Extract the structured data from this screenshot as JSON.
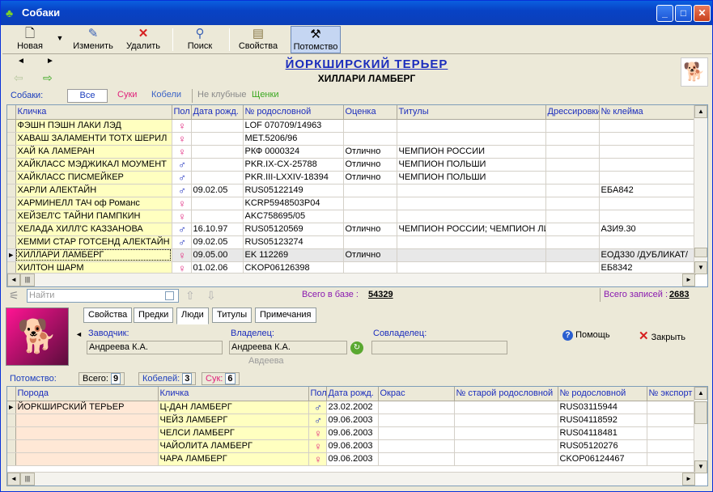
{
  "window": {
    "title": "Собаки"
  },
  "toolbar": {
    "new_label": "Новая",
    "edit_label": "Изменить",
    "delete_label": "Удалить",
    "search_label": "Поиск",
    "props_label": "Свойства",
    "offspring_label": "Потомство"
  },
  "header": {
    "breed": "ЙОРКШИРСКИЙ ТЕРЬЕР",
    "dog": "ХИЛЛАРИ ЛАМБЕРГ"
  },
  "filter": {
    "label": "Собаки:",
    "tabs": [
      "Все",
      "Суки",
      "Кобели",
      "Не клубные",
      "Щенки"
    ]
  },
  "dogs": {
    "columns": [
      "Кличка",
      "Пол",
      "Дата рожд.",
      "№ родословной",
      "Оценка",
      "Титулы",
      "Дрессировки",
      "№ клейма"
    ],
    "rows": [
      {
        "name": "ФЭШН ПЭШН ЛАКИ ЛЭД",
        "sex": "f",
        "born": "",
        "pedigree": "LOF 070709/14963",
        "grade": "",
        "titles": "",
        "training": "",
        "brand": ""
      },
      {
        "name": "ХАВАШ ЗАЛАМЕНТИ ТОТХ ШЕРИЛ",
        "sex": "f",
        "born": "",
        "pedigree": "MET.5206/96",
        "grade": "",
        "titles": "",
        "training": "",
        "brand": ""
      },
      {
        "name": "ХАЙ КА ЛАМЕРАН",
        "sex": "f",
        "born": "",
        "pedigree": "РКФ 0000324",
        "grade": "Отлично",
        "titles": "ЧЕМПИОН РОССИИ",
        "training": "",
        "brand": ""
      },
      {
        "name": "ХАЙКЛАСС МЭДЖИКАЛ МОУМЕНТ",
        "sex": "m",
        "born": "",
        "pedigree": "PKR.IX-CX-25788",
        "grade": "Отлично",
        "titles": "ЧЕМПИОН ПОЛЬШИ",
        "training": "",
        "brand": ""
      },
      {
        "name": "ХАЙКЛАСС ПИСМЕЙКЕР",
        "sex": "m",
        "born": "",
        "pedigree": "PKR.III-LXXIV-18394",
        "grade": "Отлично",
        "titles": "ЧЕМПИОН ПОЛЬШИ",
        "training": "",
        "brand": ""
      },
      {
        "name": "ХАРЛИ АЛЕКТАЙН",
        "sex": "m",
        "born": "09.02.05",
        "pedigree": "RUS05122149",
        "grade": "",
        "titles": "",
        "training": "",
        "brand": "EБA842"
      },
      {
        "name": "ХАРМИНЕЛЛ ТАЧ оф Романс",
        "sex": "f",
        "born": "",
        "pedigree": "KCRP5948503P04",
        "grade": "",
        "titles": "",
        "training": "",
        "brand": ""
      },
      {
        "name": "ХЕЙЗЕЛ'С ТАЙНИ ПАМПКИН",
        "sex": "f",
        "born": "",
        "pedigree": "AKC758695/05",
        "grade": "",
        "titles": "",
        "training": "",
        "brand": ""
      },
      {
        "name": "ХЕЛАДА ХИЛЛ'С КАЗЗАНОВА",
        "sex": "m",
        "born": "16.10.97",
        "pedigree": "RUS05120569",
        "grade": "Отлично",
        "titles": "ЧЕМПИОН РОССИИ; ЧЕМПИОН ЛИ",
        "training": "",
        "brand": "АЗИ9.30"
      },
      {
        "name": "ХЕММИ СТАР ГОТСЕНД АЛЕКТАЙН",
        "sex": "m",
        "born": "09.02.05",
        "pedigree": "RUS05123274",
        "grade": "",
        "titles": "",
        "training": "",
        "brand": ""
      },
      {
        "name": "ХИЛЛАРИ ЛАМБЕРГ",
        "sex": "f",
        "born": "09.05.00",
        "pedigree": "EK 112269",
        "grade": "Отлично",
        "titles": "",
        "training": "",
        "brand": "EOД330 /ДУБЛИКАТ/",
        "selected": true
      },
      {
        "name": "ХИЛТОН ШАРМ",
        "sex": "f",
        "born": "01.02.06",
        "pedigree": "CKOP06126398",
        "grade": "",
        "titles": "",
        "training": "",
        "brand": "EБ8342"
      }
    ]
  },
  "search": {
    "placeholder": "Найти",
    "total_label": "Всего в базе :",
    "total_value": "54329",
    "records_label": "Всего записей :",
    "records_value": "2683"
  },
  "detail_tabs": [
    "Свойства",
    "Предки",
    "Люди",
    "Титулы",
    "Примечания"
  ],
  "people": {
    "breeder_label": "Заводчик:",
    "breeder": "Андреева К.А.",
    "owner_label": "Владелец:",
    "owner": "Андреева К.А.",
    "owner_hint": "Авдеева",
    "coowner_label": "Совладелец:",
    "coowner": ""
  },
  "actions": {
    "help": "Помощь",
    "close": "Закрыть"
  },
  "offspring": {
    "label": "Потомство:",
    "total_label": "Всего:",
    "total": "9",
    "males_label": "Кобелей:",
    "males": "3",
    "females_label": "Сук:",
    "females": "6",
    "columns": [
      "Порода",
      "Кличка",
      "Пол",
      "Дата рожд.",
      "Окрас",
      "№ старой родословной",
      "№ родословной",
      "№ экспорт"
    ],
    "rows": [
      {
        "breed": "ЙОРКШИРСКИЙ ТЕРЬЕР",
        "name": "Ц-ДАН ЛАМБЕРГ",
        "sex": "m",
        "born": "23.02.2002",
        "color": "",
        "old": "",
        "pedigree": "RUS03115944"
      },
      {
        "breed": "",
        "name": "ЧЕЙЗ ЛАМБЕРГ",
        "sex": "m",
        "born": "09.06.2003",
        "color": "",
        "old": "",
        "pedigree": "RUS04118592"
      },
      {
        "breed": "",
        "name": "ЧЕЛСИ ЛАМБЕРГ",
        "sex": "f",
        "born": "09.06.2003",
        "color": "",
        "old": "",
        "pedigree": "RUS04118481"
      },
      {
        "breed": "",
        "name": "ЧАЙОЛИТА ЛАМБЕРГ",
        "sex": "f",
        "born": "09.06.2003",
        "color": "",
        "old": "",
        "pedigree": "RUS05120276"
      },
      {
        "breed": "",
        "name": "ЧАРА ЛАМБЕРГ",
        "sex": "f",
        "born": "09.06.2003",
        "color": "",
        "old": "",
        "pedigree": "CKOP06124467"
      }
    ]
  },
  "colors": {
    "female": "#e0207a",
    "male": "#1b2dbd",
    "name_bg": "#ffffc0"
  }
}
